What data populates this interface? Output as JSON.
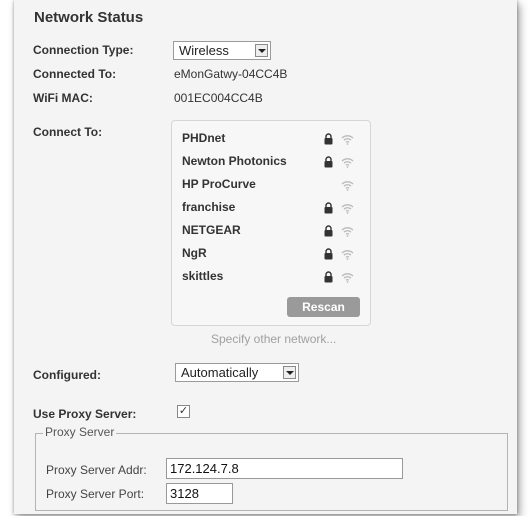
{
  "title": "Network Status",
  "connection_type": {
    "label": "Connection Type:",
    "value": "Wireless"
  },
  "connected_to": {
    "label": "Connected To:",
    "value": "eMonGatwy-04CC4B"
  },
  "wifi_mac": {
    "label": "WiFi MAC:",
    "value": "001EC004CC4B"
  },
  "connect_to": {
    "label": "Connect To:",
    "networks": [
      {
        "name": "PHDnet",
        "locked": true,
        "signal": "wifi-icon"
      },
      {
        "name": "Newton Photonics",
        "locked": true,
        "signal": "wifi-icon"
      },
      {
        "name": "HP ProCurve",
        "locked": false,
        "signal": "wifi-icon"
      },
      {
        "name": "franchise",
        "locked": true,
        "signal": "wifi-icon"
      },
      {
        "name": "NETGEAR",
        "locked": true,
        "signal": "wifi-icon"
      },
      {
        "name": "NgR",
        "locked": true,
        "signal": "wifi-icon"
      },
      {
        "name": "skittles",
        "locked": true,
        "signal": "wifi-icon"
      }
    ],
    "rescan_label": "Rescan",
    "specify_other": "Specify other network..."
  },
  "configured": {
    "label": "Configured:",
    "value": "Automatically"
  },
  "use_proxy": {
    "label": "Use Proxy Server:",
    "checked": true
  },
  "proxy": {
    "legend": "Proxy Server",
    "addr_label": "Proxy Server Addr:",
    "addr_value": "172.124.7.8",
    "port_label": "Proxy Server Port:",
    "port_value": "3128"
  },
  "colors": {
    "panel": "#f4f4f4",
    "text": "#333333",
    "muted": "#a0a0a0",
    "button": "#9a9a9a"
  }
}
